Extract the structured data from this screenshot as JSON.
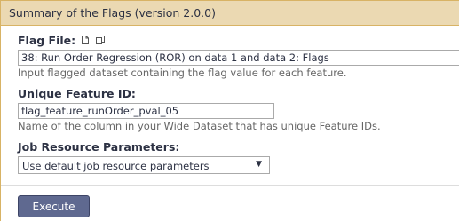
{
  "header": {
    "title": "Summary of the Flags (version 2.0.0)"
  },
  "flag_file": {
    "label": "Flag File:",
    "value": "38: Run Order Regression (ROR) on data 1 and data 2: Flags",
    "help": "Input flagged dataset containing the flag value for each feature.",
    "icons": [
      "file-icon",
      "copy-icon"
    ]
  },
  "unique_feature_id": {
    "label": "Unique Feature ID:",
    "value": "flag_feature_runOrder_pval_05",
    "help": "Name of the column in your Wide Dataset that has unique Feature IDs."
  },
  "job_resource": {
    "label": "Job Resource Parameters:",
    "value": "Use default job resource parameters",
    "arrow": "▼"
  },
  "execute": {
    "label": "Execute"
  },
  "colors": {
    "header_bg": "#ebd9b2",
    "border": "#d8b365",
    "button_bg": "#5f6990"
  }
}
